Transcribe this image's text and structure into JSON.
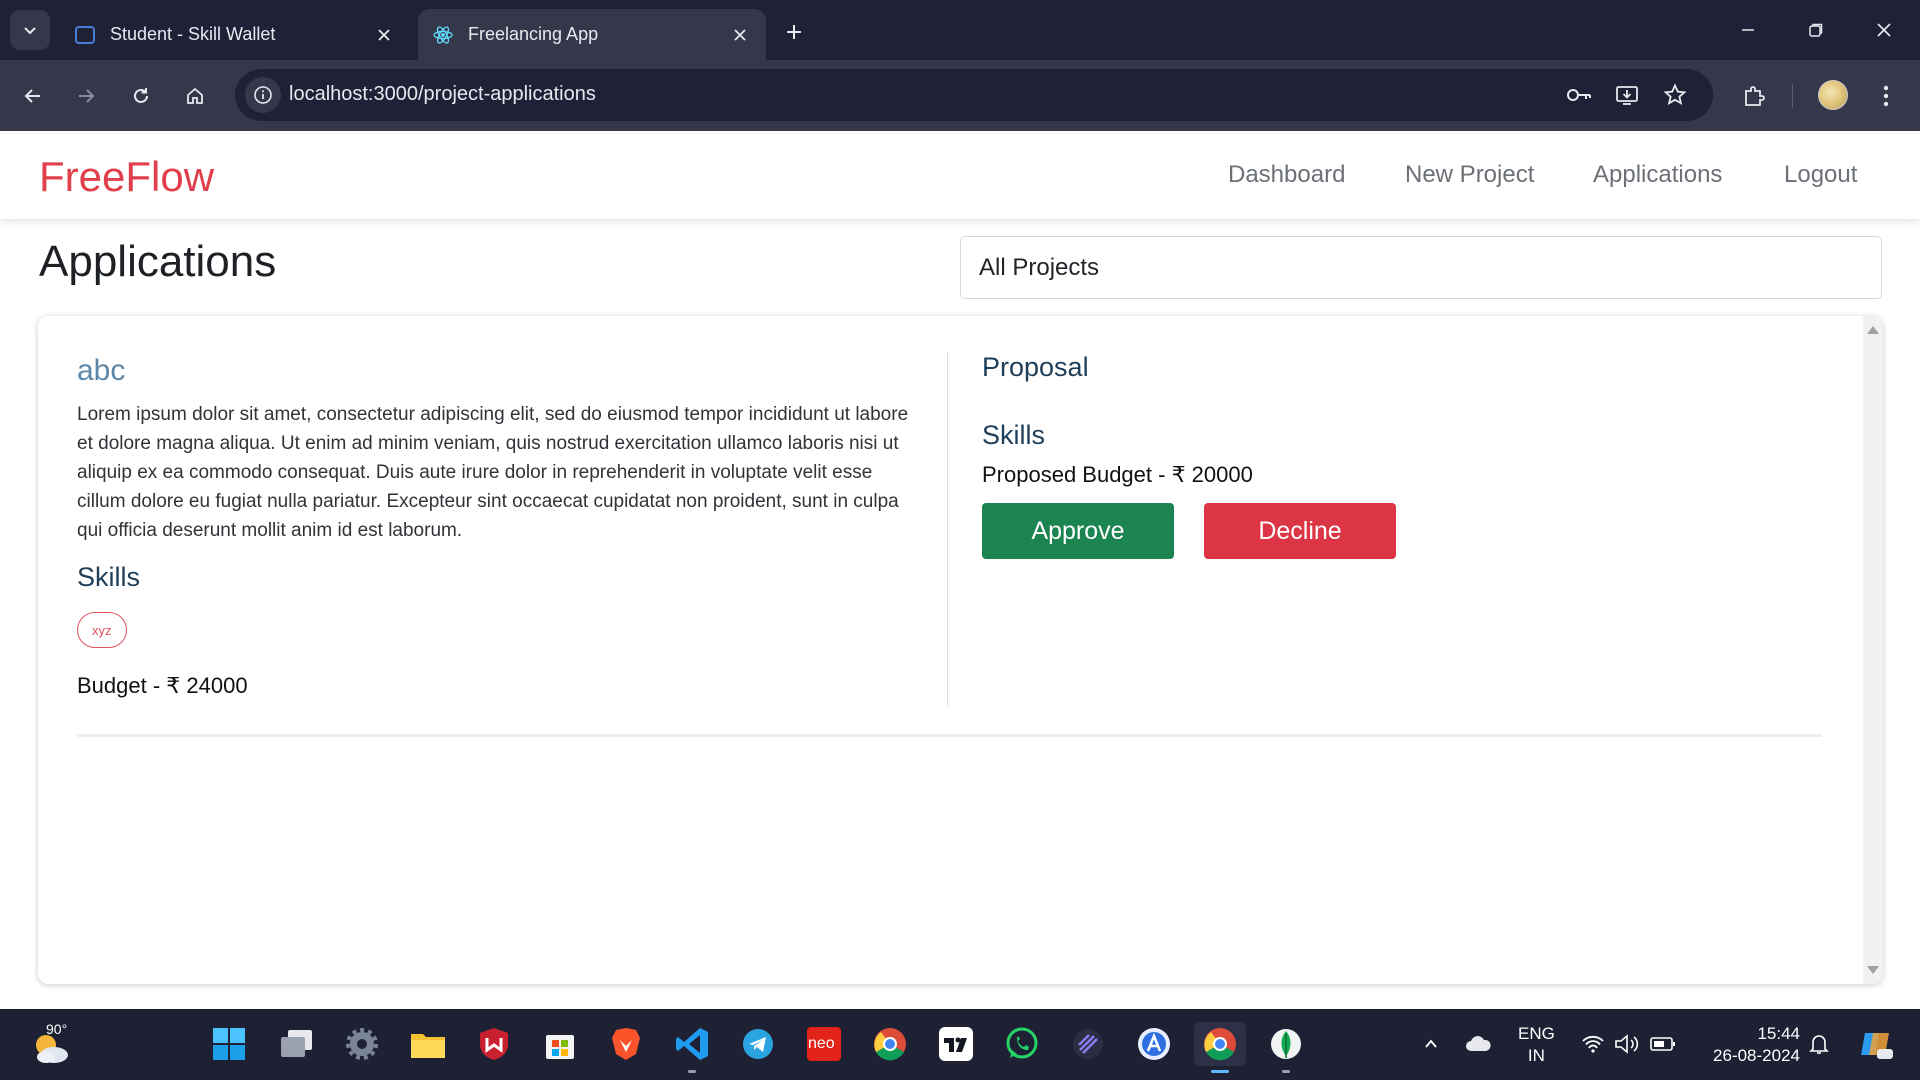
{
  "browser": {
    "tabs": [
      {
        "title": "Student - Skill Wallet",
        "active": false
      },
      {
        "title": "Freelancing App",
        "active": true
      }
    ],
    "url": "localhost:3000/project-applications"
  },
  "navbar": {
    "brand": "FreeFlow",
    "links": [
      "Dashboard",
      "New Project",
      "Applications",
      "Logout"
    ]
  },
  "page": {
    "title": "Applications",
    "filter": {
      "selected": "All Projects"
    }
  },
  "application": {
    "project_title": "abc",
    "project_description": "Lorem ipsum dolor sit amet, consectetur adipiscing elit, sed do eiusmod tempor incididunt ut labore et dolore magna aliqua. Ut enim ad minim veniam, quis nostrud exercitation ullamco laboris nisi ut aliquip ex ea commodo consequat. Duis aute irure dolor in reprehenderit in voluptate velit esse cillum dolore eu fugiat nulla pariatur. Excepteur sint occaecat cupidatat non proident, sunt in culpa qui officia deserunt mollit anim id est laborum.",
    "skills_heading": "Skills",
    "skills": [
      "xyz"
    ],
    "budget": "Budget - ₹ 24000",
    "proposal_heading": "Proposal",
    "proposal_skills_heading": "Skills",
    "proposed_budget": "Proposed Budget - ₹ 20000",
    "approve_label": "Approve",
    "decline_label": "Decline"
  },
  "taskbar": {
    "weather_temp": "90°",
    "lang_line1": "ENG",
    "lang_line2": "IN",
    "time": "15:44",
    "date": "26-08-2024",
    "neo_label": "neo"
  },
  "colors": {
    "brand": "#e0404c",
    "approve": "#1b8450",
    "decline": "#dc3545",
    "heading_blue": "#1f3e58",
    "project_title": "#5d87a8"
  }
}
